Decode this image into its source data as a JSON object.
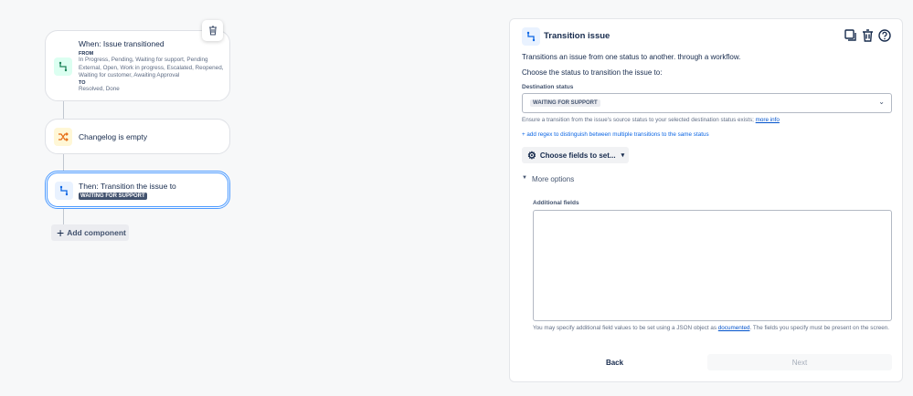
{
  "flow": {
    "trigger": {
      "title": "When: Issue transitioned",
      "from_label": "FROM",
      "from_values": "In Progress, Pending, Waiting for support, Pending External, Open, Work in progress, Escalated, Reopened, Waiting for customer, Awaiting Approval",
      "to_label": "TO",
      "to_values": "Resolved, Done"
    },
    "condition": {
      "title": "Changelog is empty"
    },
    "action": {
      "title": "Then: Transition the issue to",
      "status": "WAITING FOR SUPPORT"
    },
    "add_component": "Add component"
  },
  "panel": {
    "title": "Transition issue",
    "description": "Transitions an issue from one status to another. through a workflow.",
    "choose_prompt": "Choose the status to transition the issue to:",
    "destination_label": "Destination status",
    "destination_value": "WAITING FOR SUPPORT",
    "helper_text": "Ensure a transition from the issue's source status to your selected destination status exists;",
    "helper_link": "more info",
    "regex_link": "+ add regex to distinguish between multiple transitions to the same status",
    "choose_fields": "Choose fields to set...",
    "more_options": "More options",
    "additional_fields_label": "Additional fields",
    "additional_fields_value": "",
    "json_help_pre": "You may specify additional field values to be set using a JSON object as",
    "json_help_link": "documented",
    "json_help_post": ". The fields you specify must be present on the screen.",
    "back": "Back",
    "next": "Next"
  }
}
